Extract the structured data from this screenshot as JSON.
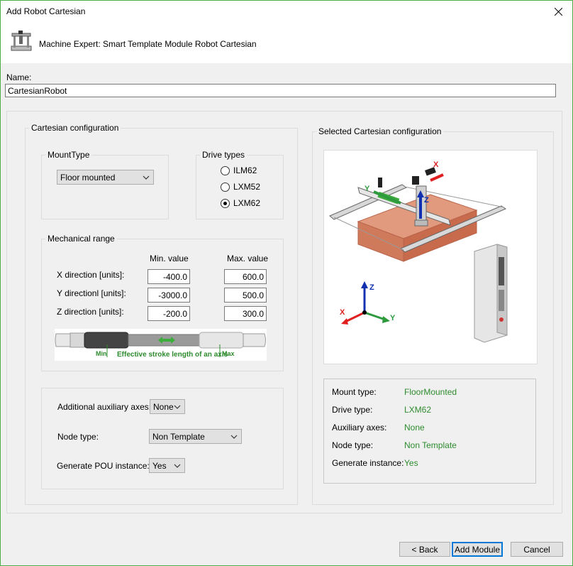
{
  "window": {
    "title": "Add Robot Cartesian"
  },
  "header": {
    "text": "Machine Expert: Smart Template Module Robot Cartesian",
    "icon": "robot-cartesian-icon"
  },
  "name": {
    "label": "Name:",
    "value": "CartesianRobot"
  },
  "cartesian_config": {
    "legend": "Cartesian configuration",
    "mount_type": {
      "legend": "MountType",
      "selected": "Floor mounted"
    },
    "drive_types": {
      "legend": "Drive types",
      "options": [
        "ILM62",
        "LXM52",
        "LXM62"
      ],
      "selected": "LXM62"
    },
    "mechanical_range": {
      "legend": "Mechanical range",
      "min_header": "Min. value",
      "max_header": "Max. value",
      "rows": [
        {
          "label": "X direction [units]:",
          "min": "-400.0",
          "max": "600.0"
        },
        {
          "label": "Y directionl [units]:",
          "min": "-3000.0",
          "max": "500.0"
        },
        {
          "label": "Z direction [units]:",
          "min": "-200.0",
          "max": "300.0"
        }
      ],
      "stroke_image": {
        "min": "Min",
        "max": "Max",
        "caption": "Effective stroke length of an axis"
      }
    },
    "options": {
      "aux_axes": {
        "label": "Additional auxiliary axes:",
        "value": "None"
      },
      "node_type": {
        "label": "Node type:",
        "value": "Non Template"
      },
      "generate_pou": {
        "label": "Generate POU instance:",
        "value": "Yes"
      }
    }
  },
  "selected_config": {
    "legend": "Selected Cartesian configuration",
    "axis_labels": {
      "x": "X",
      "y": "Y",
      "z": "Z"
    },
    "summary": [
      {
        "label": "Mount type:",
        "value": "FloorMounted"
      },
      {
        "label": "Drive type:",
        "value": "LXM62"
      },
      {
        "label": "Auxiliary axes:",
        "value": "None"
      },
      {
        "label": "Node type:",
        "value": "Non Template"
      },
      {
        "label": "Generate instance:",
        "value": "Yes"
      }
    ]
  },
  "footer": {
    "back": "< Back",
    "add": "Add Module",
    "cancel": "Cancel"
  },
  "colors": {
    "value_green": "#2e8b2e",
    "focus_blue": "#0078d7",
    "axis_red": "#e02020",
    "axis_green": "#2e9a3e",
    "axis_blue": "#1030b0"
  }
}
